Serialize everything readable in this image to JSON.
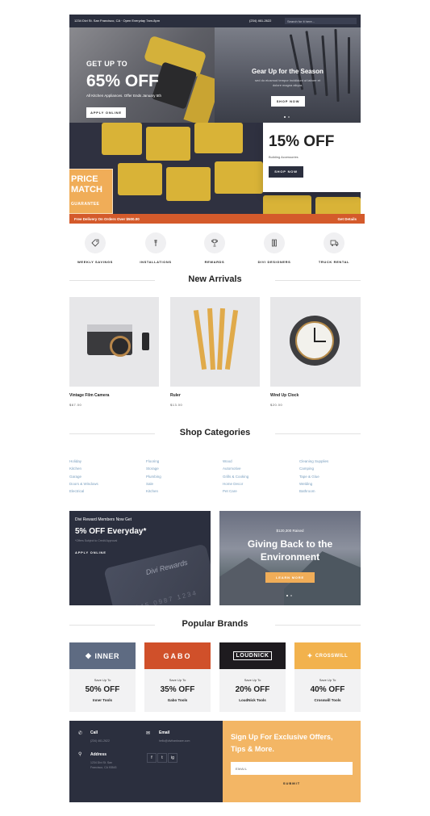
{
  "topbar": {
    "address": "1234 Divi St. San Francisco, CA · Open Everyday 7am-8pm",
    "phone": "(234) 461-2622",
    "search_placeholder": "Search for it here..."
  },
  "hero_left": {
    "eyebrow": "GET UP TO",
    "headline": "65% OFF",
    "subtext": "All Kitchen Appliances. Offer Ends January 5th",
    "button": "APPLY ONLINE"
  },
  "hero_right": {
    "headline": "Gear Up for the Season",
    "subtext": "sed do eiusmod tempor incididunt ut labore et dolore magna aliqua.",
    "button": "SHOP NOW"
  },
  "hero_bottom": {
    "headline": "15% OFF",
    "subtext": "Building Accessories",
    "button": "SHOP NOW",
    "badge_line1": "PRICE",
    "badge_line2": "MATCH",
    "badge_line3": "GUARANTEE"
  },
  "promo_strip": {
    "left": "Free Delivery On Orders Over $500.00",
    "right": "Get Details"
  },
  "features": [
    {
      "label": "WEEKLY SAVINGS",
      "icon": "tag-icon"
    },
    {
      "label": "INSTALLATIONS",
      "icon": "wrench-icon"
    },
    {
      "label": "REWARDS",
      "icon": "trophy-icon"
    },
    {
      "label": "DIVI DESIGNERS",
      "icon": "tools-icon"
    },
    {
      "label": "TRUCK RENTAL",
      "icon": "truck-icon"
    }
  ],
  "new_arrivals": {
    "title": "New Arrivals",
    "products": [
      {
        "name": "Vintage Film Camera",
        "price": "$67.00"
      },
      {
        "name": "Ruler",
        "price": "$13.00"
      },
      {
        "name": "Wind Up Clock",
        "price": "$20.00"
      }
    ]
  },
  "categories": {
    "title": "Shop Categories",
    "columns": [
      [
        "Holiday",
        "Kitchen",
        "Garage",
        "Doors & Windows",
        "Electrical"
      ],
      [
        "Flooring",
        "Storage",
        "Plumbing",
        "Sale",
        "Kitchen"
      ],
      [
        "Wood",
        "Automotive",
        "Grills & Cooking",
        "Home Decor",
        "Pet Care"
      ],
      [
        "Cleaning Supplies",
        "Camping",
        "Tape & Glue",
        "Welding",
        "Bathroom"
      ]
    ]
  },
  "promo_rewards": {
    "line1": "Divi Reward Members Now Get",
    "line2": "5% OFF Everyday*",
    "line3": "*Offers Subject to Credit Approval",
    "button": "APPLY ONLINE",
    "card_title": "Divi Rewards",
    "card_number": "2345 0987 1234"
  },
  "promo_environment": {
    "line1": "$120,300 Raised",
    "headline_1": "Giving Back to the",
    "headline_2": "Environment",
    "button": "LEARN MORE"
  },
  "brands": {
    "title": "Popular Brands",
    "items": [
      {
        "logo": "INNER",
        "save_label": "Save Up To",
        "discount": "50% OFF",
        "name": "Inner Tools",
        "color": "#5e6b82"
      },
      {
        "logo": "GABO",
        "save_label": "Save Up To",
        "discount": "35% OFF",
        "name": "Gabo Tools",
        "color": "#d0502a"
      },
      {
        "logo": "LOUDNICK",
        "save_label": "Save Up To",
        "discount": "20% OFF",
        "name": "LoudNick Tools",
        "color": "#1e1b1f"
      },
      {
        "logo": "CROSSWILL",
        "save_label": "Save Up To",
        "discount": "40% OFF",
        "name": "Crosswill Tools",
        "color": "#f2b24d"
      }
    ]
  },
  "footer": {
    "call_label": "Call",
    "call_value": "(234) 461-2622",
    "email_label": "Email",
    "email_value": "hello@divihardware.com",
    "address_label": "Address",
    "address_line1": "1234 Divi St. San",
    "address_line2": "Francisco, CA 93543",
    "social": [
      "f",
      "t",
      "ig"
    ],
    "signup_line1": "Sign Up For Exclusive Offers,",
    "signup_line2": "Tips & More.",
    "email_placeholder": "EMAIL",
    "submit": "SUBMIT"
  },
  "colors": {
    "navy": "#2b2f3e",
    "orange": "#d45a2b",
    "gold": "#f0ad58",
    "link": "#7a9fbf"
  }
}
